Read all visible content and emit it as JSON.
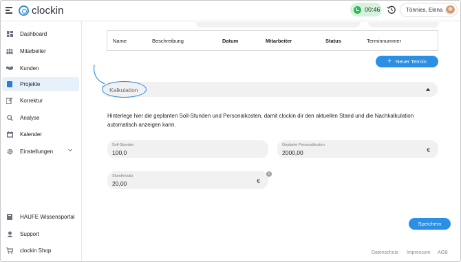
{
  "app": {
    "logo_text": "clockin"
  },
  "header": {
    "timer_text": "00:46",
    "user_name": "Tönnies, Elena"
  },
  "sidebar": {
    "top_items": [
      {
        "label": "Dashboard",
        "icon": "dashboard-icon"
      },
      {
        "label": "Mitarbeiter",
        "icon": "users-icon"
      },
      {
        "label": "Kunden",
        "icon": "handshake-icon"
      },
      {
        "label": "Projekte",
        "icon": "project-icon",
        "active": true
      },
      {
        "label": "Korrektur",
        "icon": "edit-icon"
      },
      {
        "label": "Analyse",
        "icon": "analysis-icon"
      },
      {
        "label": "Kalender",
        "icon": "calendar-icon"
      },
      {
        "label": "Einstellungen",
        "icon": "gear-icon"
      }
    ],
    "bottom_items": [
      {
        "label": "HAUFE Wissensportal",
        "icon": "book-icon"
      },
      {
        "label": "Support",
        "icon": "support-icon"
      },
      {
        "label": "clockin Shop",
        "icon": "cart-icon"
      }
    ]
  },
  "termine_table": {
    "columns": [
      "Name",
      "Beschreibung",
      "Datum",
      "Mitarbeiter",
      "Status",
      "Terminnummer"
    ]
  },
  "new_appointment_button": "Neuer Termin",
  "kalkulation": {
    "label": "Kalkulation",
    "description": "Hinterlege hier die geplanten Soll-Stunden und Personalkosten, damit clockin dir den aktuellen Stand und die Nachkalkulation automatisch anzeigen kann.",
    "fields": {
      "soll_stunden": {
        "label": "Soll-Stunden",
        "value": "100,0"
      },
      "personalkosten": {
        "label": "Geplante Personalkosten",
        "value": "2000,00",
        "unit": "€"
      },
      "stundensatz": {
        "label": "Stundensatz",
        "value": "20,00",
        "unit": "€"
      }
    },
    "info_glyph": "i"
  },
  "save_button": "Speichern",
  "footer": {
    "datenschutz": "Datenschutz",
    "impressum": "Impressum",
    "agb": "AGB"
  },
  "colors": {
    "accent": "#2b8fe3",
    "active_nav_bg": "#e6f1fb",
    "timer_bg": "#d6f1dc",
    "timer_dot": "#2fb857",
    "annotation": "#2c88d9"
  }
}
